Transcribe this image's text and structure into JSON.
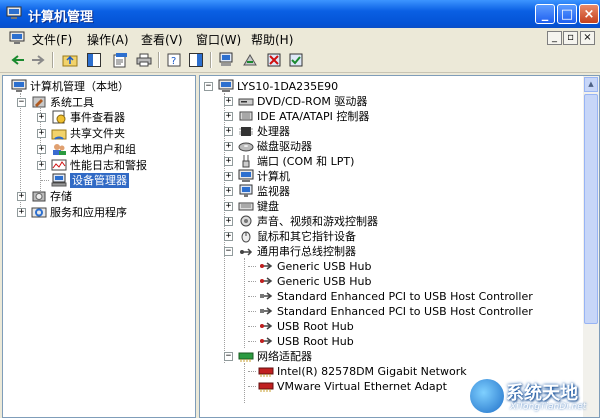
{
  "window": {
    "title": "计算机管理",
    "buttons": {
      "minimize": "_",
      "maximize": "□",
      "close": "×"
    }
  },
  "menu": [
    {
      "label": "文件(F)"
    },
    {
      "label": "操作(A)"
    },
    {
      "label": "查看(V)"
    },
    {
      "label": "窗口(W)"
    },
    {
      "label": "帮助(H)"
    }
  ],
  "mdi_buttons": {
    "minimize": "_",
    "restore": "▫",
    "close": "×"
  },
  "left_tree": [
    {
      "label": "计算机管理（本地）",
      "level": 0,
      "icon": "computer-management-icon"
    },
    {
      "label": "系统工具",
      "level": 1,
      "icon": "system-tools-icon",
      "expanded": true
    },
    {
      "label": "事件查看器",
      "level": 2,
      "icon": "event-viewer-icon",
      "expanded": false
    },
    {
      "label": "共享文件夹",
      "level": 2,
      "icon": "shared-folder-icon",
      "expanded": false
    },
    {
      "label": "本地用户和组",
      "level": 2,
      "icon": "users-icon",
      "expanded": false
    },
    {
      "label": "性能日志和警报",
      "level": 2,
      "icon": "performance-icon",
      "expanded": false
    },
    {
      "label": "设备管理器",
      "level": 2,
      "icon": "device-manager-icon",
      "selected": true
    },
    {
      "label": "存储",
      "level": 1,
      "icon": "storage-icon",
      "expanded": false
    },
    {
      "label": "服务和应用程序",
      "level": 1,
      "icon": "services-icon",
      "expanded": false
    }
  ],
  "device_tree": [
    {
      "label": "LYS10-1DA235E90",
      "level": 0,
      "icon": "computer-icon",
      "expander": "−"
    },
    {
      "label": "DVD/CD-ROM 驱动器",
      "level": 1,
      "icon": "cdrom-icon",
      "expander": "+"
    },
    {
      "label": "IDE ATA/ATAPI 控制器",
      "level": 1,
      "icon": "ide-icon",
      "expander": "+"
    },
    {
      "label": "处理器",
      "level": 1,
      "icon": "processor-icon",
      "expander": "+"
    },
    {
      "label": "磁盘驱动器",
      "level": 1,
      "icon": "disk-icon",
      "expander": "+"
    },
    {
      "label": "端口 (COM 和 LPT)",
      "level": 1,
      "icon": "port-icon",
      "expander": "+"
    },
    {
      "label": "计算机",
      "level": 1,
      "icon": "computer-icon",
      "expander": "+"
    },
    {
      "label": "监视器",
      "level": 1,
      "icon": "monitor-icon",
      "expander": "+"
    },
    {
      "label": "键盘",
      "level": 1,
      "icon": "keyboard-icon",
      "expander": "+"
    },
    {
      "label": "声音、视频和游戏控制器",
      "level": 1,
      "icon": "sound-icon",
      "expander": "+"
    },
    {
      "label": "鼠标和其它指针设备",
      "level": 1,
      "icon": "mouse-icon",
      "expander": "+"
    },
    {
      "label": "通用串行总线控制器",
      "level": 1,
      "icon": "usb-icon",
      "expander": "−"
    },
    {
      "label": "Generic USB Hub",
      "level": 2,
      "icon": "usb-hub-icon"
    },
    {
      "label": "Generic USB Hub",
      "level": 2,
      "icon": "usb-hub-icon"
    },
    {
      "label": "Standard Enhanced PCI to USB Host Controller",
      "level": 2,
      "icon": "usb-controller-icon"
    },
    {
      "label": "Standard Enhanced PCI to USB Host Controller",
      "level": 2,
      "icon": "usb-controller-icon"
    },
    {
      "label": "USB Root Hub",
      "level": 2,
      "icon": "usb-hub-icon"
    },
    {
      "label": "USB Root Hub",
      "level": 2,
      "icon": "usb-hub-icon"
    },
    {
      "label": "网络适配器",
      "level": 1,
      "icon": "network-icon",
      "expander": "−"
    },
    {
      "label": "Intel(R) 82578DM Gigabit Network",
      "level": 2,
      "icon": "network-card-icon"
    },
    {
      "label": "VMware Virtual Ethernet Adapt",
      "level": 2,
      "icon": "network-card-icon"
    }
  ],
  "watermark": {
    "title": "系统天地",
    "subtitle": "XiTongTianDi.net"
  },
  "colors": {
    "title_bar": "#0a5fe3",
    "selection": "#316ac5",
    "pane_border": "#7f9db9"
  }
}
